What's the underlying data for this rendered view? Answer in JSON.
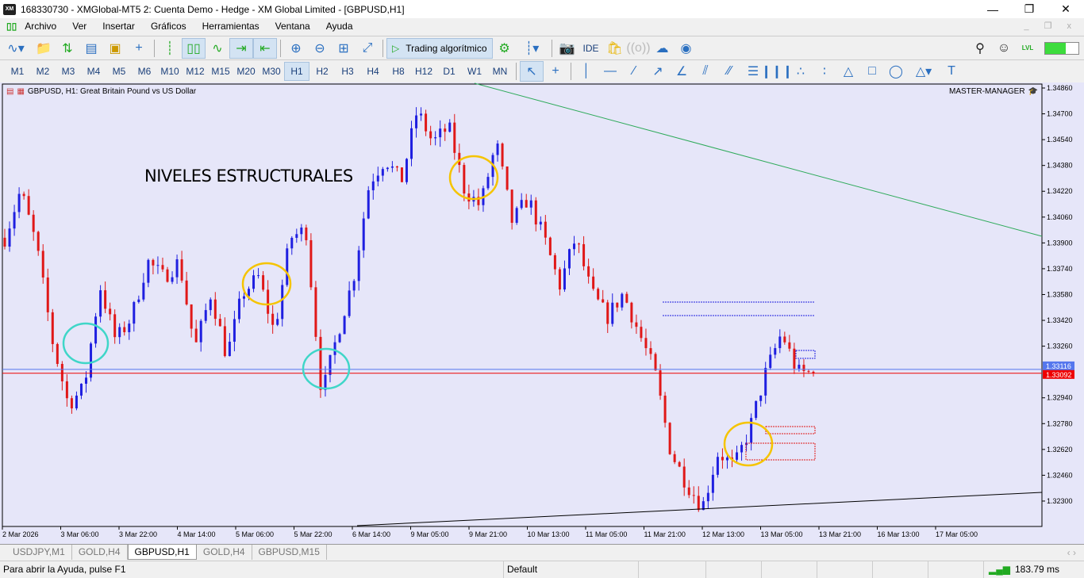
{
  "window": {
    "title": "168330730 - XMGlobal-MT5 2: Cuenta Demo - Hedge - XM Global Limited - [GBPUSD,H1]",
    "logo": "XM"
  },
  "menu": [
    "Archivo",
    "Ver",
    "Insertar",
    "Gráficos",
    "Herramientas",
    "Ventana",
    "Ayuda"
  ],
  "toolbar": {
    "algo_label": "Trading algorítmico",
    "ide_label": "IDE",
    "lvl_label": "LVL"
  },
  "timeframes": [
    "M1",
    "M2",
    "M3",
    "M4",
    "M5",
    "M6",
    "M10",
    "M12",
    "M15",
    "M20",
    "M30",
    "H1",
    "H2",
    "H3",
    "H4",
    "H8",
    "H12",
    "D1",
    "W1",
    "MN"
  ],
  "active_timeframe": "H1",
  "chart": {
    "header": "GBPUSD, H1:  Great Britain Pound vs US Dollar",
    "indicator": "MASTER-MANAGER",
    "annotation": "NIVELES ESTRUCTURALES",
    "bid_label": "1.33092",
    "ask_label": "1.33116"
  },
  "chart_data": {
    "type": "candlestick",
    "symbol": "GBPUSD",
    "timeframe": "H1",
    "ylim": [
      1.322,
      1.349
    ],
    "y_ticks": [
      "1.34860",
      "1.34700",
      "1.34540",
      "1.34380",
      "1.34220",
      "1.34060",
      "1.33900",
      "1.33740",
      "1.33580",
      "1.33420",
      "1.33260",
      "1.32940",
      "1.32780",
      "1.32620",
      "1.32460",
      "1.32300"
    ],
    "x_ticks": [
      "2 Mar 2026",
      "3 Mar 06:00",
      "3 Mar 22:00",
      "4 Mar 14:00",
      "5 Mar 06:00",
      "5 Mar 22:00",
      "6 Mar 14:00",
      "9 Mar 05:00",
      "9 Mar 21:00",
      "10 Mar 13:00",
      "11 Mar 05:00",
      "11 Mar 21:00",
      "12 Mar 13:00",
      "13 Mar 05:00",
      "13 Mar 21:00",
      "16 Mar 13:00",
      "17 Mar 05:00"
    ],
    "close_path": [
      1.33932,
      1.34227,
      1.33883,
      1.33294,
      1.32901,
      1.32999,
      1.33637,
      1.33294,
      1.33441,
      1.33785,
      1.33687,
      1.33785,
      1.33245,
      1.33588,
      1.33195,
      1.33588,
      1.33687,
      1.33343,
      1.33932,
      1.33981,
      1.3295,
      1.33343,
      1.33687,
      1.34276,
      1.34423,
      1.34276,
      1.34718,
      1.34521,
      1.34619,
      1.34227,
      1.34128,
      1.34521,
      1.3403,
      1.34177,
      1.33932,
      1.33637,
      1.33932,
      1.33588,
      1.33441,
      1.33588,
      1.33343,
      1.33097,
      1.32606,
      1.3241,
      1.32263,
      1.32606,
      1.32508,
      1.32754,
      1.33097,
      1.33343,
      1.33097,
      1.33092
    ],
    "bid": 1.33092,
    "ask": 1.33116,
    "colors": {
      "bull": "#1f1fe0",
      "bear": "#e01818",
      "background": "#e6e6f9",
      "trend_upper": "#2eaa5a",
      "trend_lower": "#000000",
      "circle_cyan": "#3fd6c8",
      "circle_yellow": "#f5c400"
    }
  },
  "tabs": [
    "USDJPY,M1",
    "GOLD,H4",
    "GBPUSD,H1",
    "GOLD,H4",
    "GBPUSD,M15"
  ],
  "active_tab": "GBPUSD,H1",
  "status": {
    "help": "Para abrir la Ayuda, pulse F1",
    "profile": "Default",
    "ping": "183.79 ms"
  }
}
